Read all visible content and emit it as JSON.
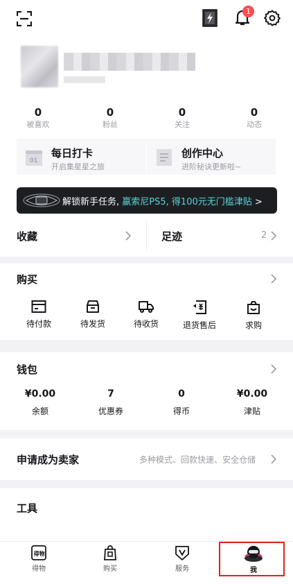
{
  "header": {
    "scan_icon": "scan-icon",
    "badge_icon": "lightning-card-icon",
    "notifications": {
      "icon": "bell-icon",
      "count": "1"
    },
    "settings_icon": "gear-icon"
  },
  "stats": [
    {
      "value": "0",
      "label": "被喜欢"
    },
    {
      "value": "0",
      "label": "粉丝"
    },
    {
      "value": "0",
      "label": "关注"
    },
    {
      "value": "0",
      "label": "动态"
    }
  ],
  "cards": [
    {
      "title": "每日打卡",
      "subtitle": "开启集星星之旅",
      "icon": "calendar-01-icon"
    },
    {
      "title": "创作中心",
      "subtitle": "进阶秘诀更新啦~",
      "icon": "document-icon"
    }
  ],
  "banner": {
    "text_main": "解锁新手任务,",
    "text_highlight": "赢索尼PS5,",
    "text_tail": "得100元无门槛津贴",
    "chevron": ">"
  },
  "favorites": {
    "label": "收藏"
  },
  "footprint": {
    "label": "足迹",
    "count": "2"
  },
  "purchase": {
    "title": "购买",
    "items": [
      {
        "label": "待付款",
        "icon": "card-icon"
      },
      {
        "label": "待发货",
        "icon": "box-icon"
      },
      {
        "label": "待收货",
        "icon": "truck-icon"
      },
      {
        "label": "退货售后",
        "icon": "refund-icon"
      },
      {
        "label": "求购",
        "icon": "bag-icon"
      }
    ]
  },
  "wallet": {
    "title": "钱包",
    "items": [
      {
        "value": "¥0.00",
        "label": "余额"
      },
      {
        "value": "7",
        "label": "优惠券"
      },
      {
        "value": "0",
        "label": "得币"
      },
      {
        "value": "¥0.00",
        "label": "津贴"
      }
    ]
  },
  "seller": {
    "title": "申请成为卖家",
    "subtitle": "多种模式、回款快速、安全仓储"
  },
  "tools": {
    "title": "工具"
  },
  "tabs": [
    {
      "label": "得物",
      "icon": "dewu-logo-icon"
    },
    {
      "label": "购买",
      "icon": "shopping-bag-icon"
    },
    {
      "label": "服务",
      "icon": "service-shield-icon"
    },
    {
      "label": "我",
      "icon": "profile-avatar-icon",
      "active": true
    }
  ],
  "colors": {
    "accent": "#58d4d8",
    "badge": "#ff4d4f",
    "highlight_box": "#e02020"
  }
}
